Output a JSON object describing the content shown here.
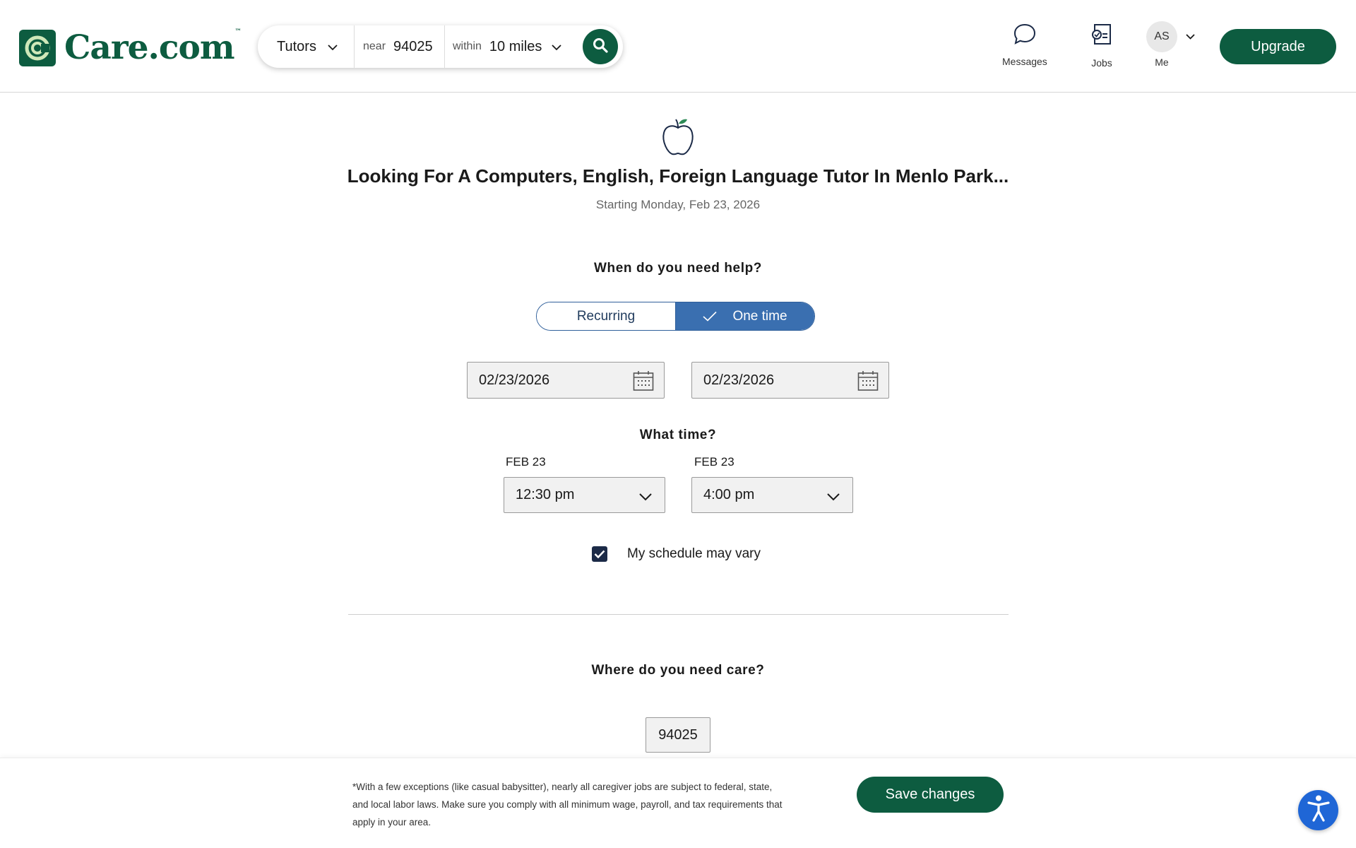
{
  "header": {
    "logo_text": "Care.com",
    "logo_tm": "™",
    "search": {
      "service": "Tutors",
      "near_label": "near",
      "near_value": "94025",
      "within_label": "within",
      "within_value": "10 miles"
    },
    "nav": {
      "messages": "Messages",
      "jobs": "Jobs",
      "avatar_initials": "AS",
      "me": "Me"
    },
    "upgrade_label": "Upgrade"
  },
  "job": {
    "title": "Looking For A Computers, English, Foreign Language Tutor In Menlo Park...",
    "subtitle": "Starting Monday, Feb 23, 2026"
  },
  "schedule": {
    "question": "When do you need help?",
    "toggle": {
      "recurring": "Recurring",
      "one_time": "One time",
      "selected": "One time"
    },
    "start_date": "02/23/2026",
    "end_date": "02/23/2026",
    "time_question": "What time?",
    "start_day_label": "FEB 23",
    "end_day_label": "FEB 23",
    "start_time": "12:30 pm",
    "end_time": "4:00 pm",
    "schedule_vary_label": "My schedule may vary",
    "schedule_vary_checked": true
  },
  "location": {
    "question": "Where do you need care?",
    "zip": "94025"
  },
  "footer": {
    "disclaimer": "*With a few exceptions (like casual babysitter), nearly all caregiver jobs are subject to federal, state, and local labor laws. Make sure you comply with all minimum wage, payroll, and tax requirements that apply in your area.",
    "save_label": "Save changes"
  },
  "colors": {
    "brand_green": "#0d5c40",
    "toggle_blue": "#3a6fb0",
    "a11y_blue": "#1f66d6"
  },
  "icons": [
    "care-logo-icon",
    "chevron-down-icon",
    "search-icon",
    "message-bubble-icon",
    "jobs-icon",
    "apple-icon",
    "checkmark-icon",
    "calendar-icon",
    "accessibility-icon"
  ]
}
